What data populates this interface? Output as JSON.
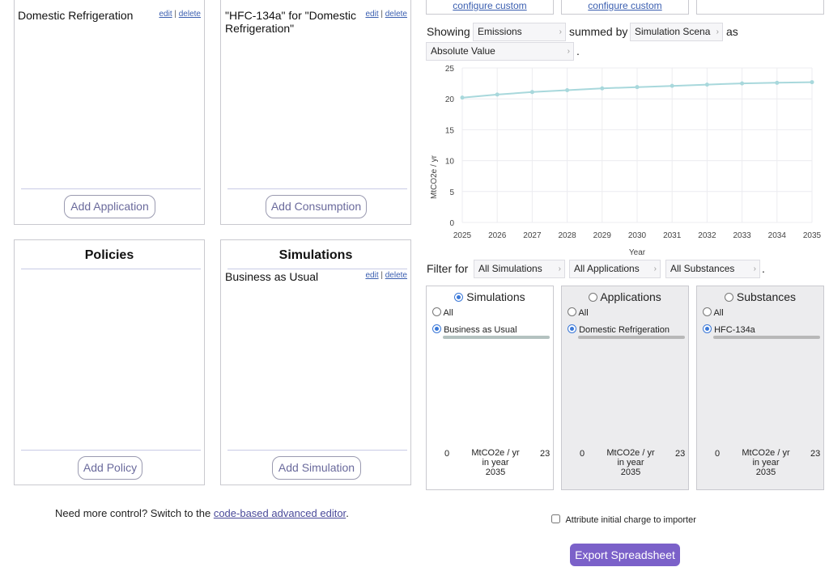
{
  "applications": {
    "items": [
      {
        "label": "Domestic Refrigeration",
        "edit": "edit",
        "delete": "delete"
      }
    ],
    "add_label": "Add Application"
  },
  "consumption": {
    "items": [
      {
        "label": "\"HFC-134a\" for \"Domestic Refrigeration\"",
        "edit": "edit",
        "delete": "delete"
      }
    ],
    "add_label": "Add Consumption"
  },
  "policies": {
    "title": "Policies",
    "add_label": "Add Policy"
  },
  "simulations": {
    "title": "Simulations",
    "items": [
      {
        "label": "Business as Usual",
        "edit": "edit",
        "delete": "delete"
      }
    ],
    "add_label": "Add Simulation"
  },
  "footer_note": {
    "prefix": "Need more control? Switch to the ",
    "link": "code-based advanced editor",
    "suffix": "."
  },
  "top_buttons": [
    {
      "label": "configure custom"
    },
    {
      "label": "configure custom"
    },
    {
      "label": ""
    }
  ],
  "showing": {
    "label": "Showing",
    "metric": "Emissions",
    "summed_label": "summed by",
    "summed_by": "Simulation Scena",
    "as_label": "as",
    "value_mode": "Absolute Value",
    "period": "."
  },
  "chart_data": {
    "type": "line",
    "ylabel": "MtCO2e / yr",
    "xlabel": "Year",
    "ylim": [
      0,
      25
    ],
    "yticks": [
      0,
      5,
      10,
      15,
      20,
      25
    ],
    "x": [
      2025,
      2026,
      2027,
      2028,
      2029,
      2030,
      2031,
      2032,
      2033,
      2034,
      2035
    ],
    "series": [
      {
        "values": [
          20.2,
          20.7,
          21.1,
          21.4,
          21.7,
          21.9,
          22.1,
          22.3,
          22.5,
          22.6,
          22.7
        ]
      }
    ],
    "grid": true,
    "line_color": "#a8d8dc"
  },
  "filter": {
    "label": "Filter for",
    "simulations": "All Simulations",
    "applications": "All Applications",
    "substances": "All Substances",
    "period": "."
  },
  "cards": [
    {
      "heading": "Simulations",
      "all": "All",
      "option": "Business as Usual",
      "min": "0",
      "unit": "MtCO2e / yr",
      "in_year": "in year",
      "year": "2035",
      "max": "23",
      "selected": true
    },
    {
      "heading": "Applications",
      "all": "All",
      "option": "Domestic Refrigeration",
      "min": "0",
      "unit": "MtCO2e / yr",
      "in_year": "in year",
      "year": "2035",
      "max": "23",
      "selected": false
    },
    {
      "heading": "Substances",
      "all": "All",
      "option": "HFC-134a",
      "min": "0",
      "unit": "MtCO2e / yr",
      "in_year": "in year",
      "year": "2035",
      "max": "23",
      "selected": false
    }
  ],
  "attribute_checkbox": {
    "label": "Attribute initial charge to importer",
    "checked": false
  },
  "export_label": "Export Spreadsheet"
}
